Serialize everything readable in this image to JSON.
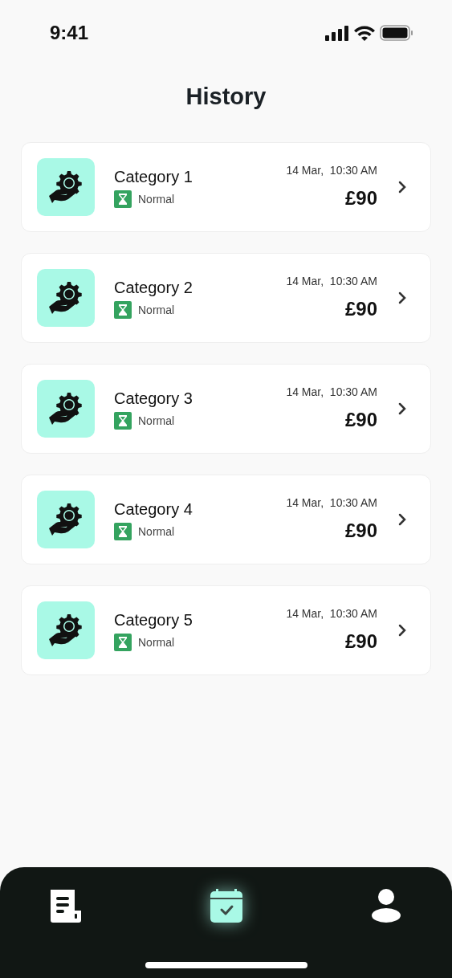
{
  "status_bar": {
    "time": "9:41"
  },
  "title": "History",
  "items": [
    {
      "category": "Category 1",
      "status": "Normal",
      "date": "14 Mar,  10:30 AM",
      "amount": "£90"
    },
    {
      "category": "Category 2",
      "status": "Normal",
      "date": "14 Mar,  10:30 AM",
      "amount": "£90"
    },
    {
      "category": "Category 3",
      "status": "Normal",
      "date": "14 Mar,  10:30 AM",
      "amount": "£90"
    },
    {
      "category": "Category 4",
      "status": "Normal",
      "date": "14 Mar,  10:30 AM",
      "amount": "£90"
    },
    {
      "category": "Category 5",
      "status": "Normal",
      "date": "14 Mar,  10:30 AM",
      "amount": "£90"
    }
  ],
  "nav": [
    {
      "kind": "document",
      "selected": false
    },
    {
      "kind": "calendar",
      "selected": true
    },
    {
      "kind": "profile",
      "selected": false
    }
  ]
}
